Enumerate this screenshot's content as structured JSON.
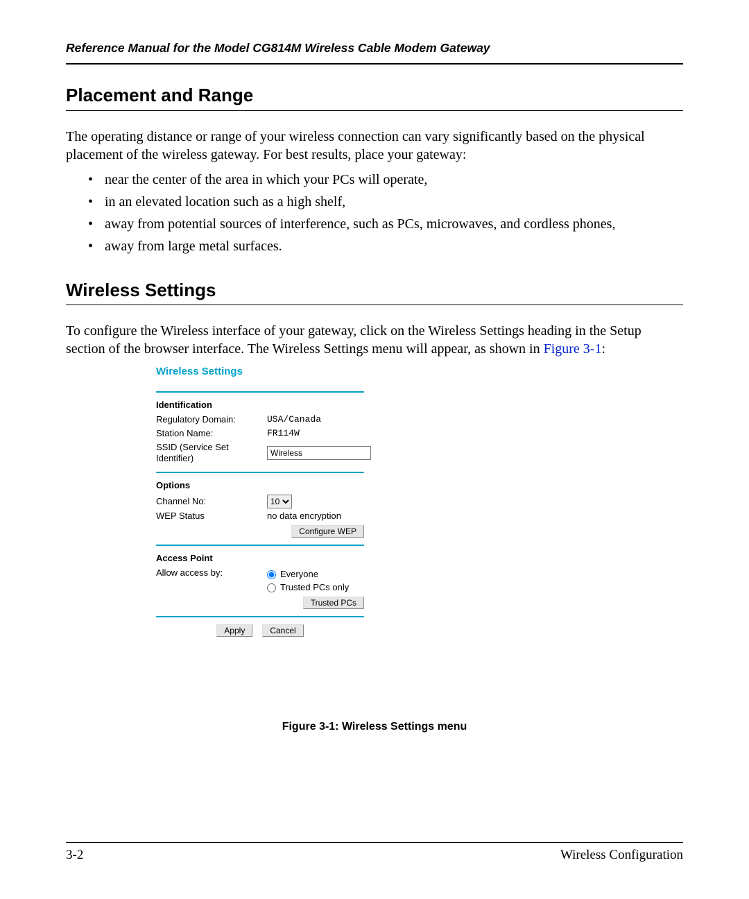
{
  "header": "Reference Manual for the Model CG814M Wireless Cable Modem Gateway",
  "section1": {
    "title": "Placement and Range"
  },
  "para1": "The operating distance or range of your wireless connection can vary significantly based on the physical placement of the wireless gateway. For best results, place your gateway:",
  "bullets": [
    "near the center of the area in which your PCs will operate,",
    "in an elevated location such as a high shelf,",
    "away from potential sources of interference, such as PCs, microwaves, and cordless phones,",
    "away from large metal surfaces."
  ],
  "section2": {
    "title": "Wireless Settings"
  },
  "para2_a": "To configure the Wireless interface of your gateway, click on the Wireless Settings heading in the Setup section of the browser interface. The Wireless Settings menu will appear, as shown in ",
  "xref": "Figure 3-1",
  "para2_b": ":",
  "figure": {
    "title": "Wireless Settings",
    "identification": {
      "heading": "Identification",
      "domain_label": "Regulatory Domain:",
      "domain_value": "USA/Canada",
      "station_label": "Station Name:",
      "station_value": "FR114W",
      "ssid_label": "SSID (Service Set Identifier)",
      "ssid_value": "Wireless"
    },
    "options": {
      "heading": "Options",
      "channel_label": "Channel No:",
      "channel_value": "10",
      "wep_label": "WEP Status",
      "wep_value": "no data encryption",
      "configure_btn": "Configure WEP"
    },
    "access": {
      "heading": "Access Point",
      "allow_label": "Allow access by:",
      "opt1": "Everyone",
      "opt2": "Trusted PCs only",
      "trusted_btn": "Trusted PCs"
    },
    "apply_btn": "Apply",
    "cancel_btn": "Cancel",
    "caption": "Figure 3-1:  Wireless Settings menu"
  },
  "footer": {
    "page": "3-2",
    "section": "Wireless Configuration"
  }
}
